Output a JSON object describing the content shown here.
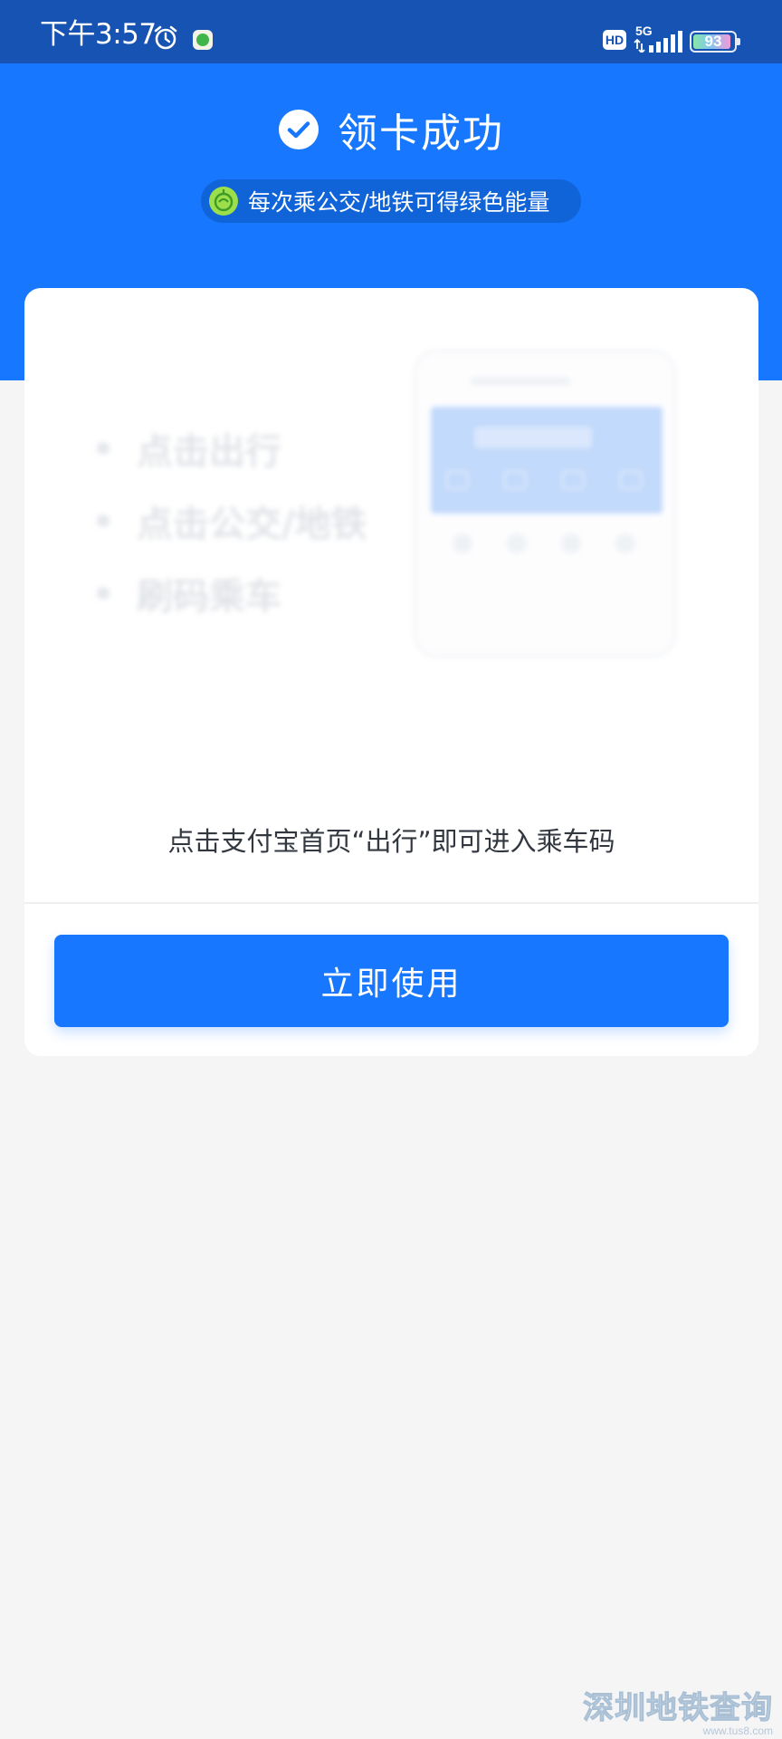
{
  "status_bar": {
    "time": "下午3:57",
    "network_badge": "HD",
    "network_type": "5G",
    "battery_level": "93",
    "icons": [
      "alarm-clock-icon",
      "app-notification-icon",
      "signal-bars-icon",
      "battery-icon"
    ]
  },
  "header": {
    "title": "领卡成功",
    "energy_text": "每次乘公交/地铁可得绿色能量",
    "colors": {
      "band": "#1777ff",
      "status_bar": "#1653b2",
      "check_icon": "#1777ff",
      "leaf_icon": "#9be04a"
    }
  },
  "card": {
    "guide_steps": [
      "点击出行",
      "点击公交/地铁",
      "刷码乘车"
    ],
    "hint": "点击支付宝首页“出行”即可进入乘车码",
    "button_label": "立即使用",
    "button_color": "#1777ff"
  },
  "watermark": {
    "text": "深圳地铁查询",
    "url": "www.tus8.com"
  }
}
